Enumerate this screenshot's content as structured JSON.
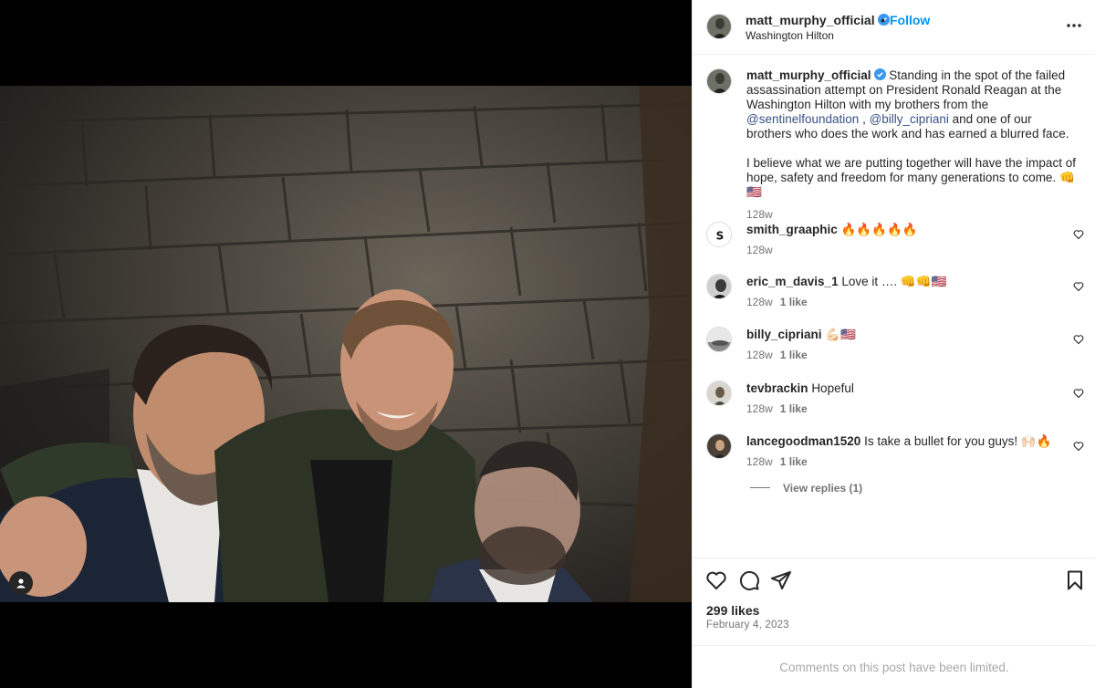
{
  "post": {
    "username": "matt_murphy_official",
    "location": "Washington Hilton",
    "follow_label": "Follow",
    "separator": "•",
    "more_icon": "more-horizontal-icon"
  },
  "caption": {
    "username": "matt_murphy_official",
    "text_1": "Standing in the spot of the failed assassination attempt on President Ronald Reagan at the Washington Hilton with my brothers from the",
    "mention_1": "@sentinelfoundation",
    "comma": ",",
    "mention_2": "@billy_cipriani",
    "text_2": "and one of our brothers who does the work and has earned a blurred face.",
    "text_3": "I believe what we are putting together will have the impact of hope, safety and freedom for many generations to come. 👊🇺🇸",
    "age": "128w"
  },
  "comments": [
    {
      "username": "smith_graaphic",
      "text": "🔥🔥🔥🔥🔥",
      "age": "128w",
      "likes": ""
    },
    {
      "username": "eric_m_davis_1",
      "text": "Love it …. 👊👊🇺🇸",
      "age": "128w",
      "likes": "1 like"
    },
    {
      "username": "billy_cipriani",
      "text": "💪🏻🇺🇸",
      "age": "128w",
      "likes": "1 like"
    },
    {
      "username": "tevbrackin",
      "text": "Hopeful",
      "age": "128w",
      "likes": "1 like"
    },
    {
      "username": "lancegoodman1520",
      "text": "Is take a bullet for you guys! 🙌🏻🔥",
      "age": "128w",
      "likes": "1 like"
    }
  ],
  "view_replies": "View replies (1)",
  "likes_label": "299 likes",
  "date_label": "February 4, 2023",
  "limited_label": "Comments on this post have been limited.",
  "colors": {
    "accent": "#0095f6",
    "verified": "#3897f0",
    "muted": "#737373",
    "border": "#efefef"
  }
}
